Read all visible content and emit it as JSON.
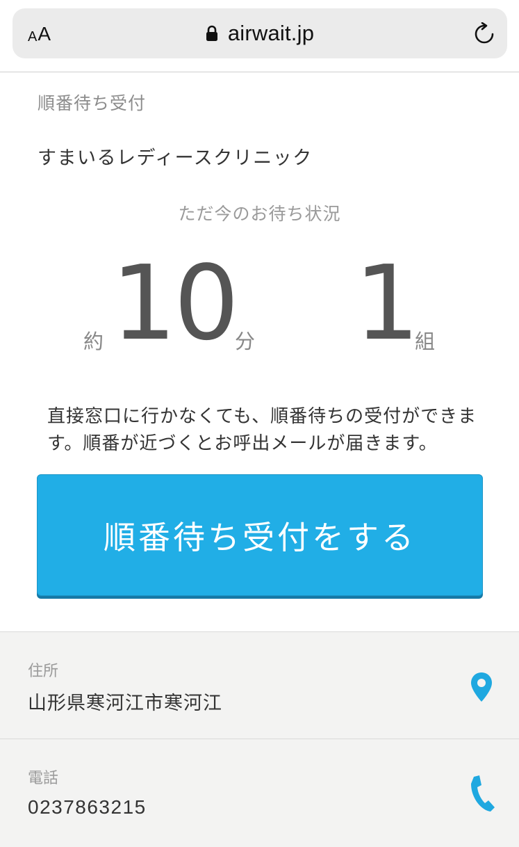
{
  "browser": {
    "text_size_small": "A",
    "text_size_large": "A",
    "url": "airwait.jp",
    "icons": {
      "lock": "lock-icon",
      "reload": "reload-icon"
    }
  },
  "page": {
    "label": "順番待ち受付",
    "clinic_name": "すまいるレディースクリニック",
    "status_heading": "ただ今のお待ち状況",
    "wait": {
      "approx_prefix": "約",
      "minutes": "10",
      "minutes_unit": "分",
      "groups": "1",
      "groups_unit": "組"
    },
    "description": "直接窓口に行かなくても、順番待ちの受付ができます。順番が近づくとお呼出メールが届きます。",
    "cta_label": "順番待ち受付をする"
  },
  "info": {
    "address_label": "住所",
    "address_value": "山形県寒河江市寒河江",
    "phone_label": "電話",
    "phone_value": "0237863215",
    "icons": {
      "address": "map-pin-icon",
      "phone": "phone-icon"
    }
  },
  "colors": {
    "accent": "#21aee6",
    "icon_blue": "#1fa8e0",
    "info_bg": "#f3f3f2"
  }
}
